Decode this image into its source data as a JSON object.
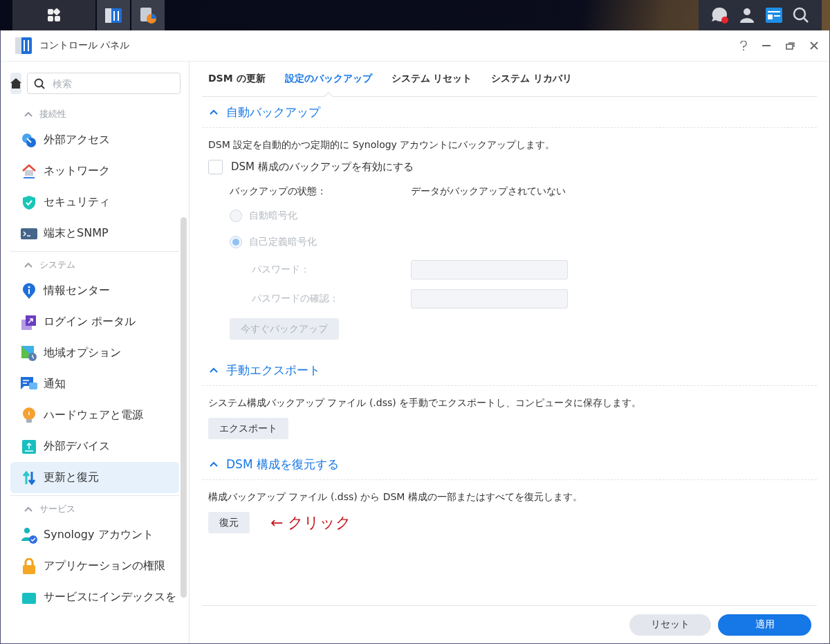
{
  "window": {
    "title": "コントロール パネル"
  },
  "sidebar": {
    "search": {
      "placeholder": "検索"
    },
    "groups": [
      {
        "title": "接続性",
        "expanded": true,
        "items": [
          {
            "label": "外部アクセス",
            "selected": false
          },
          {
            "label": "ネットワーク",
            "selected": false
          },
          {
            "label": "セキュリティ",
            "selected": false
          },
          {
            "label": "端末とSNMP",
            "selected": false
          }
        ]
      },
      {
        "title": "システム",
        "expanded": true,
        "items": [
          {
            "label": "情報センター",
            "selected": false
          },
          {
            "label": "ログイン ポータル",
            "selected": false
          },
          {
            "label": "地域オプション",
            "selected": false
          },
          {
            "label": "通知",
            "selected": false
          },
          {
            "label": "ハードウェアと電源",
            "selected": false
          },
          {
            "label": "外部デバイス",
            "selected": false
          },
          {
            "label": "更新と復元",
            "selected": true
          }
        ]
      },
      {
        "title": "サービス",
        "expanded": true,
        "items": [
          {
            "label": "Synology アカウント",
            "selected": false
          },
          {
            "label": "アプリケーションの権限",
            "selected": false
          },
          {
            "label": "サービスにインデックスを",
            "selected": false
          }
        ]
      }
    ]
  },
  "tabs": [
    {
      "label": "DSM の更新",
      "selected": false
    },
    {
      "label": "設定のバックアップ",
      "selected": true
    },
    {
      "label": "システム リセット",
      "selected": false
    },
    {
      "label": "システム リカバリ",
      "selected": false
    }
  ],
  "auto_backup": {
    "title": "自動バックアップ",
    "expanded": true,
    "description": "DSM 設定を自動的かつ定期的に Synology アカウントにバックアップします。",
    "enable": {
      "label": "DSM 構成のバックアップを有効にする",
      "checked": false
    },
    "status": {
      "label": "バックアップの状態：",
      "value": "データがバックアップされていない"
    },
    "encryption": [
      {
        "label": "自動暗号化",
        "selected": false,
        "disabled": true
      },
      {
        "label": "自己定義暗号化",
        "selected": true,
        "disabled": true
      }
    ],
    "fields": [
      {
        "label": "パスワード：",
        "disabled": true
      },
      {
        "label": "パスワードの確認：",
        "disabled": true
      }
    ],
    "button": {
      "label": "今すぐバックアップ",
      "disabled": true
    }
  },
  "manual_export": {
    "title": "手動エクスポート",
    "expanded": true,
    "description": "システム構成バックアップ ファイル (.dss) を手動でエクスポートし、コンピュータに保存します。",
    "button": {
      "label": "エクスポート",
      "disabled": false
    }
  },
  "restore": {
    "title": "DSM 構成を復元する",
    "expanded": true,
    "description": "構成バックアップ ファイル (.dss) から DSM 構成の一部またはすべてを復元します。",
    "button": {
      "label": "復元",
      "disabled": false
    },
    "annotation": "← クリック"
  },
  "footer": {
    "buttons": [
      {
        "label": "リセット",
        "kind": "secondary"
      },
      {
        "label": "適用",
        "kind": "primary"
      }
    ]
  }
}
